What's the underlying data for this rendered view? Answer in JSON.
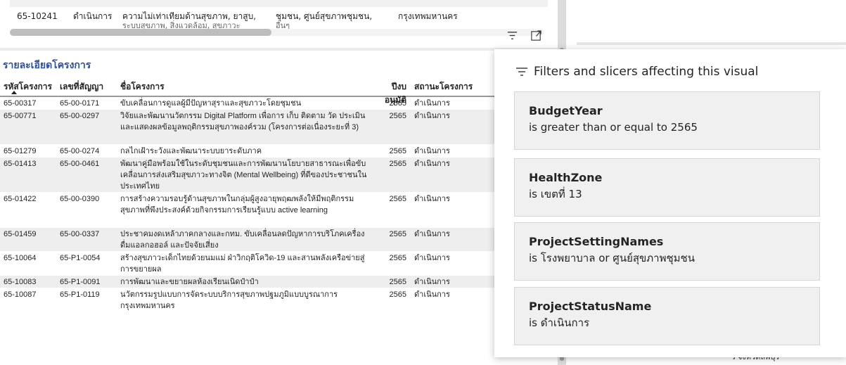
{
  "top_row": {
    "code": "65-10241",
    "status": "ดำเนินการ",
    "issue": "ความไม่เท่าเทียมด้านสุขภาพ, ยาสูบ,",
    "issue_clip": "ระบบสุขภาพ, สิ่งแวดล้อม, สุขภาวะ",
    "setting": "ชุมชน, ศูนย์สุขภาพชุมชน,",
    "setting_clip": "อื่นๆ",
    "province": "กรุงเทพมหานคร"
  },
  "visual_header": {
    "filter_icon": "filter-icon",
    "focus_icon": "focus-mode-icon"
  },
  "table": {
    "title": "รายละเอียดโครงการ",
    "headers": [
      "รหัสโครงการ",
      "เลขที่สัญญา",
      "ชื่อโครงการ",
      "ปีงบอนุมัติ",
      "สถานะโครงการ"
    ],
    "rows": [
      {
        "code": "65-00317",
        "contract": "65-00-0171",
        "name": "ขับเคลื่อนการดูแลผู้มีปัญหาสุราและสุขภาวะโดยชุมชน",
        "year": "2565",
        "status": "ดำเนินการ"
      },
      {
        "code": "65-00771",
        "contract": "65-00-0297",
        "name": "วิจัยและพัฒนานวัตกรรม Digital Platform เพื่อการ เก็บ ติดตาม วัด ประเมิน และแสดงผลข้อมูลพฤติกรรมสุขภาพองค์รวม (โครงการต่อเนื่องระยะที่ 3)",
        "year": "2565",
        "status": "ดำเนินการ"
      },
      {
        "code": "65-01279",
        "contract": "65-00-0274",
        "name": "กลไกเฝ้าระวังและพัฒนาระบบยาระดับภาค",
        "year": "2565",
        "status": "ดำเนินการ"
      },
      {
        "code": "65-01413",
        "contract": "65-00-0461",
        "name": "พัฒนาคู่มือพร้อมใช้ในระดับชุมชนและการพัฒนานโยบายสาธารณะเพื่อขับเคลื่อนการส่งเสริมสุขภาวะทางจิต (Mental Wellbeing) ที่ดีของประชาชนในประเทศไทย",
        "year": "2565",
        "status": "ดำเนินการ"
      },
      {
        "code": "65-01422",
        "contract": "65-00-0390",
        "name": "การสร้างความรอบรู้ด้านสุขภาพในกลุ่มผู้สูงอายุพฤฒพลังให้มีพฤติกรรมสุขภาพที่พึงประสงค์ด้วยกิจกรรมการเรียนรู้แบบ active learning",
        "year": "2565",
        "status": "ดำเนินการ"
      },
      {
        "code": "65-01459",
        "contract": "65-00-0337",
        "name": "ประชาคมงดเหล้าภาคกลางและกทม. ขับเคลื่อนลดปัญหาการบริโภคเครื่องดื่มแอลกอฮอล์ และปัจจัยเสี่ยง",
        "year": "2565",
        "status": "ดำเนินการ"
      },
      {
        "code": "65-10064",
        "contract": "65-P1-0054",
        "name": "สร้างสุขภาวะเด็กไทยด้วยนมแม่ ฝ่าวิกฤติโควิด-19 และสานพลังเครือข่ายสู่การขยายผล",
        "year": "2565",
        "status": "ดำเนินการ"
      },
      {
        "code": "65-10083",
        "contract": "65-P1-0091",
        "name": "การพัฒนาและขยายผลห้องเรียนเนิดป๋าป๋า",
        "year": "2565",
        "status": "ดำเนินการ"
      },
      {
        "code": "65-10087",
        "contract": "65-P1-0119",
        "name": "นวัตกรรมรูปแบบการจัดระบบบริการสุขภาพปฐมภูมิแบบบูรณาการ กรุงเทพมหานคร",
        "year": "2565",
        "status": "ดำเนินการ"
      }
    ]
  },
  "right_peek": {
    "bottom_text": "ร จังหวัดลพบุรี"
  },
  "flyout": {
    "title": "Filters and slicers affecting this visual",
    "filters": [
      {
        "name": "BudgetYear",
        "condition": "is greater than or equal to 2565"
      },
      {
        "name": "HealthZone",
        "condition": "is เขตที่ 13"
      },
      {
        "name": "ProjectSettingNames",
        "condition": "is โรงพยาบาล or ศูนย์สุขภาพชุมชน"
      },
      {
        "name": "ProjectStatusName",
        "condition": "is ดำเนินการ"
      }
    ]
  }
}
